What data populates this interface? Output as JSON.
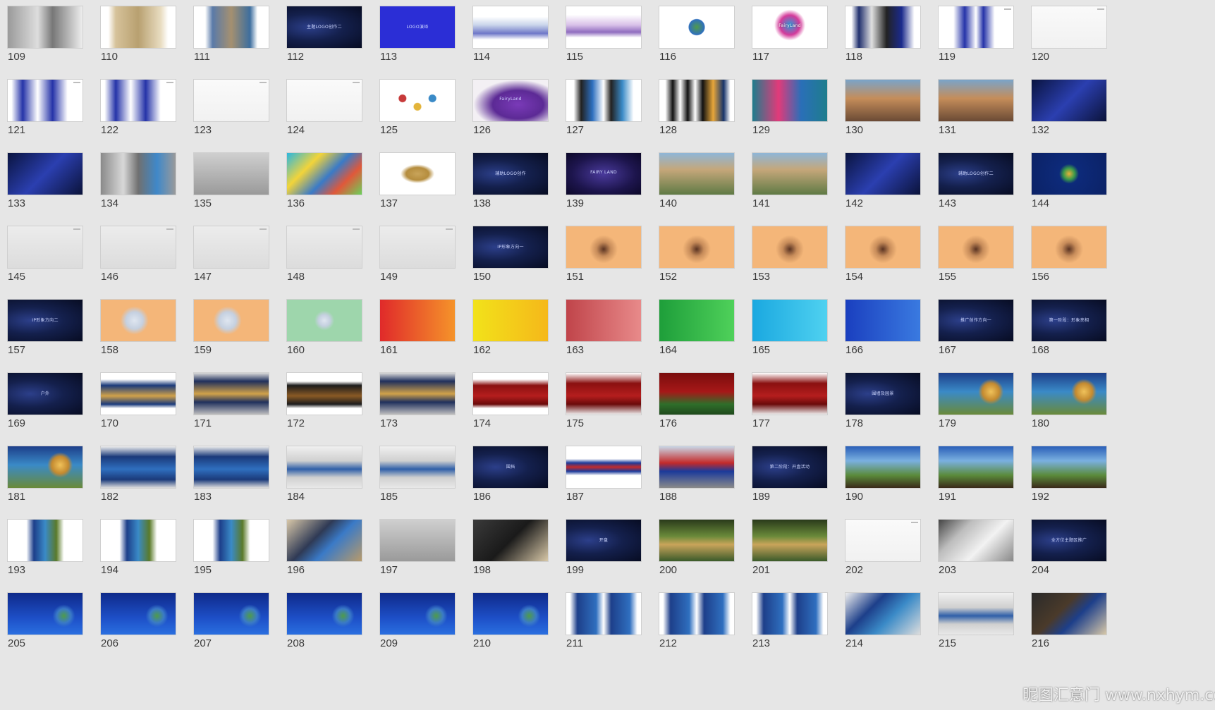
{
  "thumbnails": [
    {
      "number": "109",
      "style": "gray-collage"
    },
    {
      "number": "110",
      "style": "map-tan"
    },
    {
      "number": "111",
      "style": "photos"
    },
    {
      "number": "112",
      "style": "dark-blue",
      "caption": "主题LOGO创作二"
    },
    {
      "number": "113",
      "style": "solid-blue",
      "caption": "LOGO演绎"
    },
    {
      "number": "114",
      "style": "skyline"
    },
    {
      "number": "115",
      "style": "skyline-line"
    },
    {
      "number": "116",
      "style": "globe"
    },
    {
      "number": "117",
      "style": "logo",
      "caption": "FairyLand"
    },
    {
      "number": "118",
      "style": "mixed"
    },
    {
      "number": "119",
      "style": "white-blue"
    },
    {
      "number": "120",
      "style": "white-doc"
    },
    {
      "number": "121",
      "style": "stationery"
    },
    {
      "number": "122",
      "style": "stationery"
    },
    {
      "number": "123",
      "style": "white-doc"
    },
    {
      "number": "124",
      "style": "white-doc"
    },
    {
      "number": "125",
      "style": "badges"
    },
    {
      "number": "126",
      "style": "purple-shirt",
      "caption": "FairyLand"
    },
    {
      "number": "127",
      "style": "screens"
    },
    {
      "number": "128",
      "style": "phones"
    },
    {
      "number": "129",
      "style": "teal-cards"
    },
    {
      "number": "130",
      "style": "castle"
    },
    {
      "number": "131",
      "style": "castle"
    },
    {
      "number": "132",
      "style": "night-blue"
    },
    {
      "number": "133",
      "style": "night-blue"
    },
    {
      "number": "134",
      "style": "gray-gate"
    },
    {
      "number": "135",
      "style": "gray-room"
    },
    {
      "number": "136",
      "style": "colorful"
    },
    {
      "number": "137",
      "style": "scroll"
    },
    {
      "number": "138",
      "style": "dark-blue",
      "caption": "辅助LOGO创作"
    },
    {
      "number": "139",
      "style": "purple-logo",
      "caption": "FAIRY LAND"
    },
    {
      "number": "140",
      "style": "park"
    },
    {
      "number": "141",
      "style": "park"
    },
    {
      "number": "142",
      "style": "night-blue"
    },
    {
      "number": "143",
      "style": "dark-blue",
      "caption": "辅助LOGO创作二"
    },
    {
      "number": "144",
      "style": "navy-logo"
    },
    {
      "number": "145",
      "style": "light-gray"
    },
    {
      "number": "146",
      "style": "light-gray"
    },
    {
      "number": "147",
      "style": "light-gray"
    },
    {
      "number": "148",
      "style": "light-gray"
    },
    {
      "number": "149",
      "style": "light-gray"
    },
    {
      "number": "150",
      "style": "dark-blue",
      "caption": "IP形象方向一"
    },
    {
      "number": "151",
      "style": "orange-char"
    },
    {
      "number": "152",
      "style": "orange-char"
    },
    {
      "number": "153",
      "style": "orange-char"
    },
    {
      "number": "154",
      "style": "orange-char"
    },
    {
      "number": "155",
      "style": "orange-char"
    },
    {
      "number": "156",
      "style": "orange-char"
    },
    {
      "number": "157",
      "style": "dark-blue",
      "caption": "IP形象方向二"
    },
    {
      "number": "158",
      "style": "orange-elephant"
    },
    {
      "number": "159",
      "style": "orange-elephant"
    },
    {
      "number": "160",
      "style": "green-elephant"
    },
    {
      "number": "161",
      "style": "red-grad"
    },
    {
      "number": "162",
      "style": "yellow"
    },
    {
      "number": "163",
      "style": "rose"
    },
    {
      "number": "164",
      "style": "green"
    },
    {
      "number": "165",
      "style": "cyan"
    },
    {
      "number": "166",
      "style": "blue"
    },
    {
      "number": "167",
      "style": "dark-blue",
      "caption": "推广创作方向一"
    },
    {
      "number": "168",
      "style": "dark-blue",
      "caption": "第一阶段：形象亮相"
    },
    {
      "number": "169",
      "style": "dark-blue",
      "caption": "户外"
    },
    {
      "number": "170",
      "style": "banner-gold"
    },
    {
      "number": "171",
      "style": "billboard"
    },
    {
      "number": "172",
      "style": "banner-dark"
    },
    {
      "number": "173",
      "style": "billboard"
    },
    {
      "number": "174",
      "style": "banner-red"
    },
    {
      "number": "175",
      "style": "billboard-red"
    },
    {
      "number": "176",
      "style": "banner-red-green"
    },
    {
      "number": "177",
      "style": "billboard-red"
    },
    {
      "number": "178",
      "style": "dark-blue",
      "caption": "围墙及园景"
    },
    {
      "number": "179",
      "style": "poster-gold"
    },
    {
      "number": "180",
      "style": "poster-gold"
    },
    {
      "number": "181",
      "style": "poster-gold"
    },
    {
      "number": "182",
      "style": "billboard-blue"
    },
    {
      "number": "183",
      "style": "billboard-blue"
    },
    {
      "number": "184",
      "style": "hall"
    },
    {
      "number": "185",
      "style": "hall"
    },
    {
      "number": "186",
      "style": "dark-blue",
      "caption": "围挡"
    },
    {
      "number": "187",
      "style": "fence"
    },
    {
      "number": "188",
      "style": "fence-photo"
    },
    {
      "number": "189",
      "style": "dark-blue",
      "caption": "第二阶段：开盘活动"
    },
    {
      "number": "190",
      "style": "poster-sky"
    },
    {
      "number": "191",
      "style": "poster-sky"
    },
    {
      "number": "192",
      "style": "poster-sky"
    },
    {
      "number": "193",
      "style": "vertical-poster"
    },
    {
      "number": "194",
      "style": "vertical-poster"
    },
    {
      "number": "195",
      "style": "vertical-poster"
    },
    {
      "number": "196",
      "style": "tablet"
    },
    {
      "number": "197",
      "style": "gray-room"
    },
    {
      "number": "198",
      "style": "phone-dark"
    },
    {
      "number": "199",
      "style": "dark-blue",
      "caption": "开盘"
    },
    {
      "number": "200",
      "style": "poster-green"
    },
    {
      "number": "201",
      "style": "poster-green"
    },
    {
      "number": "202",
      "style": "white-doc"
    },
    {
      "number": "203",
      "style": "newspaper"
    },
    {
      "number": "204",
      "style": "dark-blue",
      "caption": "全方位主题区推广"
    },
    {
      "number": "205",
      "style": "blue-globe"
    },
    {
      "number": "206",
      "style": "blue-globe"
    },
    {
      "number": "207",
      "style": "blue-globe"
    },
    {
      "number": "208",
      "style": "blue-globe"
    },
    {
      "number": "209",
      "style": "blue-globe"
    },
    {
      "number": "210",
      "style": "blue-globe"
    },
    {
      "number": "211",
      "style": "poster-pair"
    },
    {
      "number": "212",
      "style": "poster-pair"
    },
    {
      "number": "213",
      "style": "poster-pair"
    },
    {
      "number": "214",
      "style": "tablet-blue"
    },
    {
      "number": "215",
      "style": "hall"
    },
    {
      "number": "216",
      "style": "laptop"
    }
  ],
  "watermark": "昵图汇意门 www.nxhym.com"
}
